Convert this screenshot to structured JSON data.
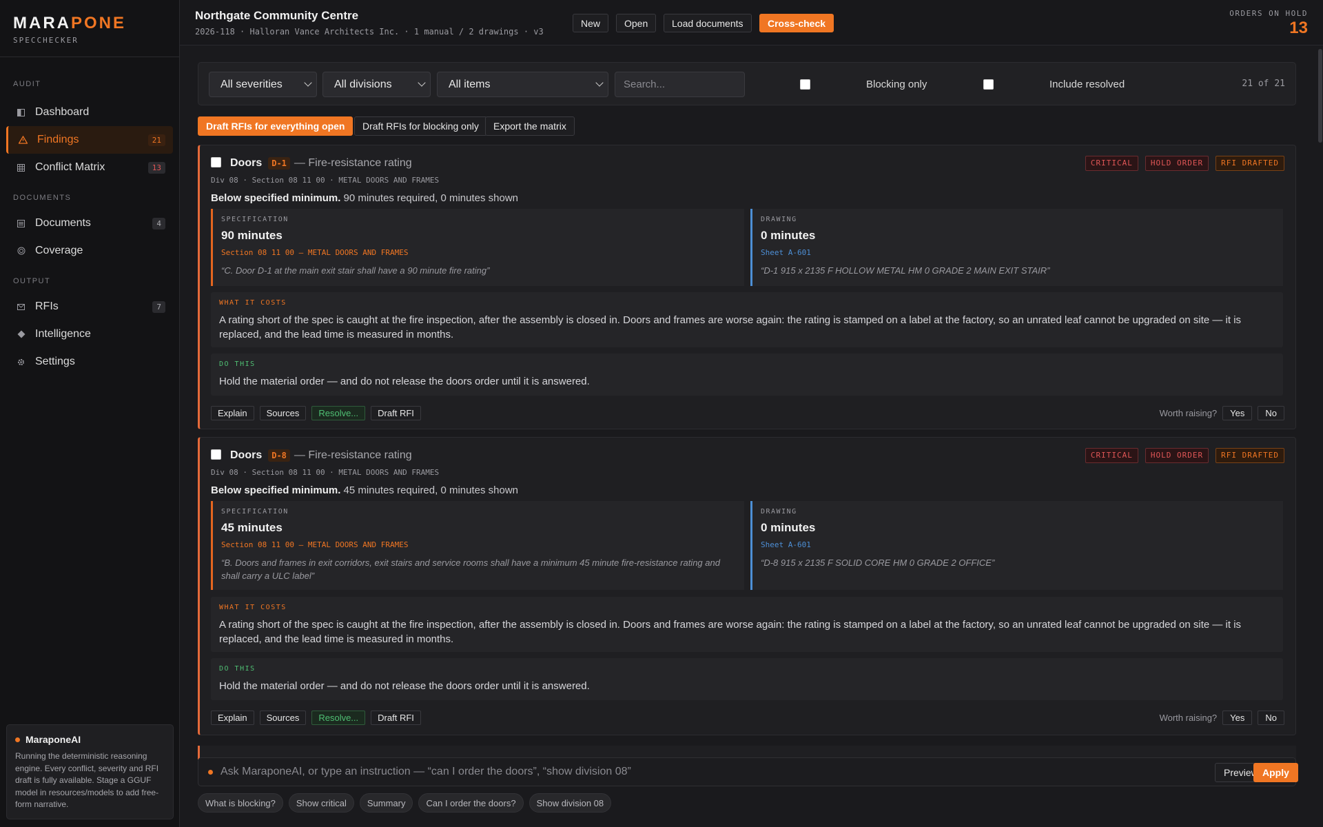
{
  "brand": {
    "logo_a": "MARA",
    "logo_b": "PONE",
    "sub": "SPECCHECKER"
  },
  "nav": {
    "sections": [
      "AUDIT",
      "DOCUMENTS",
      "OUTPUT"
    ],
    "items": [
      {
        "label": "Dashboard",
        "badge": "",
        "icon": "dashboard-icon"
      },
      {
        "label": "Findings",
        "badge": "21",
        "icon": "warning-icon"
      },
      {
        "label": "Conflict Matrix",
        "badge": "13",
        "icon": "grid-icon"
      },
      {
        "label": "Documents",
        "badge": "4",
        "icon": "documents-icon"
      },
      {
        "label": "Coverage",
        "badge": "",
        "icon": "coverage-icon"
      },
      {
        "label": "RFIs",
        "badge": "7",
        "icon": "mail-icon"
      },
      {
        "label": "Intelligence",
        "badge": "",
        "icon": "diamond-icon"
      },
      {
        "label": "Settings",
        "badge": "",
        "icon": "gear-icon"
      }
    ]
  },
  "ai_card": {
    "title": "MaraponeAI",
    "text": "Running the deterministic reasoning engine. Every conflict, severity and RFI draft is fully available. Stage a GGUF model in resources/models to add free-form narrative."
  },
  "header": {
    "title": "Northgate Community Centre",
    "subtitle": "2026-118 · Halloran Vance Architects Inc. · 1 manual / 2 drawings · v3",
    "buttons": {
      "new": "New",
      "open": "Open",
      "load": "Load documents",
      "cross": "Cross-check"
    },
    "hold_label": "ORDERS ON HOLD",
    "hold_count": "13"
  },
  "filters": {
    "severity": "All severities",
    "division": "All divisions",
    "items": "All items",
    "search_placeholder": "Search...",
    "blocking_label": "Blocking only",
    "resolved_label": "Include resolved",
    "count": "21 of 21"
  },
  "actions": {
    "draft_all": "Draft RFIs for everything open",
    "draft_blocking": "Draft RFIs for blocking only",
    "export": "Export the matrix"
  },
  "badges": {
    "critical": "CRITICAL",
    "hold": "HOLD ORDER",
    "rfi": "RFI DRAFTED"
  },
  "labels": {
    "spec": "SPECIFICATION",
    "drawing": "DRAWING",
    "cost": "WHAT IT COSTS",
    "do": "DO THIS",
    "worth": "Worth raising?",
    "yes": "Yes",
    "no": "No"
  },
  "card_buttons": {
    "explain": "Explain",
    "sources": "Sources",
    "resolve": "Resolve...",
    "draft": "Draft RFI"
  },
  "findings": [
    {
      "category": "Doors",
      "tag": "D-1",
      "topic": "— Fire-resistance rating",
      "division": "Div 08 · Section 08 11 00 · METAL DOORS AND FRAMES",
      "summary_bold": "Below specified minimum.",
      "summary": " 90 minutes required, 0 minutes shown",
      "spec_value": "90 minutes",
      "spec_ref": "Section 08 11 00 — METAL DOORS AND FRAMES",
      "spec_quote": "“C. Door D-1 at the main exit stair shall have a 90 minute fire rating”",
      "draw_value": "0 minutes",
      "draw_ref": "Sheet A-601",
      "draw_quote": "“D-1 915 x 2135 F HOLLOW METAL HM 0 GRADE 2 MAIN EXIT STAIR”",
      "cost": "A rating short of the spec is caught at the fire inspection, after the assembly is closed in. Doors and frames are worse again: the rating is stamped on a label at the factory, so an unrated leaf cannot be upgraded on site — it is replaced, and the lead time is measured in months.",
      "do": "Hold the material order — and do not release the doors order until it is answered."
    },
    {
      "category": "Doors",
      "tag": "D-8",
      "topic": "— Fire-resistance rating",
      "division": "Div 08 · Section 08 11 00 · METAL DOORS AND FRAMES",
      "summary_bold": "Below specified minimum.",
      "summary": " 45 minutes required, 0 minutes shown",
      "spec_value": "45 minutes",
      "spec_ref": "Section 08 11 00 — METAL DOORS AND FRAMES",
      "spec_quote": "“B. Doors and frames in exit corridors, exit stairs and service rooms shall have a minimum 45 minute fire-resistance rating and shall carry a ULC label”",
      "draw_value": "0 minutes",
      "draw_ref": "Sheet A-601",
      "draw_quote": "“D-8 915 x 2135 F SOLID CORE HM 0 GRADE 2 OFFICE”",
      "cost": "A rating short of the spec is caught at the fire inspection, after the assembly is closed in. Doors and frames are worse again: the rating is stamped on a label at the factory, so an unrated leaf cannot be upgraded on site — it is replaced, and the lead time is measured in months.",
      "do": "Hold the material order — and do not release the doors order until it is answered."
    }
  ],
  "ask": {
    "placeholder": "Ask MaraponeAI, or type an instruction — “can I order the doors”, “show division 08”",
    "preview": "Preview",
    "apply": "Apply"
  },
  "chips": [
    "What is blocking?",
    "Show critical",
    "Summary",
    "Can I order the doors?",
    "Show division 08"
  ],
  "colors": {
    "accent": "#f07623",
    "critical": "#e05656",
    "drawing": "#4d8fd6",
    "ok": "#4fbf73"
  }
}
